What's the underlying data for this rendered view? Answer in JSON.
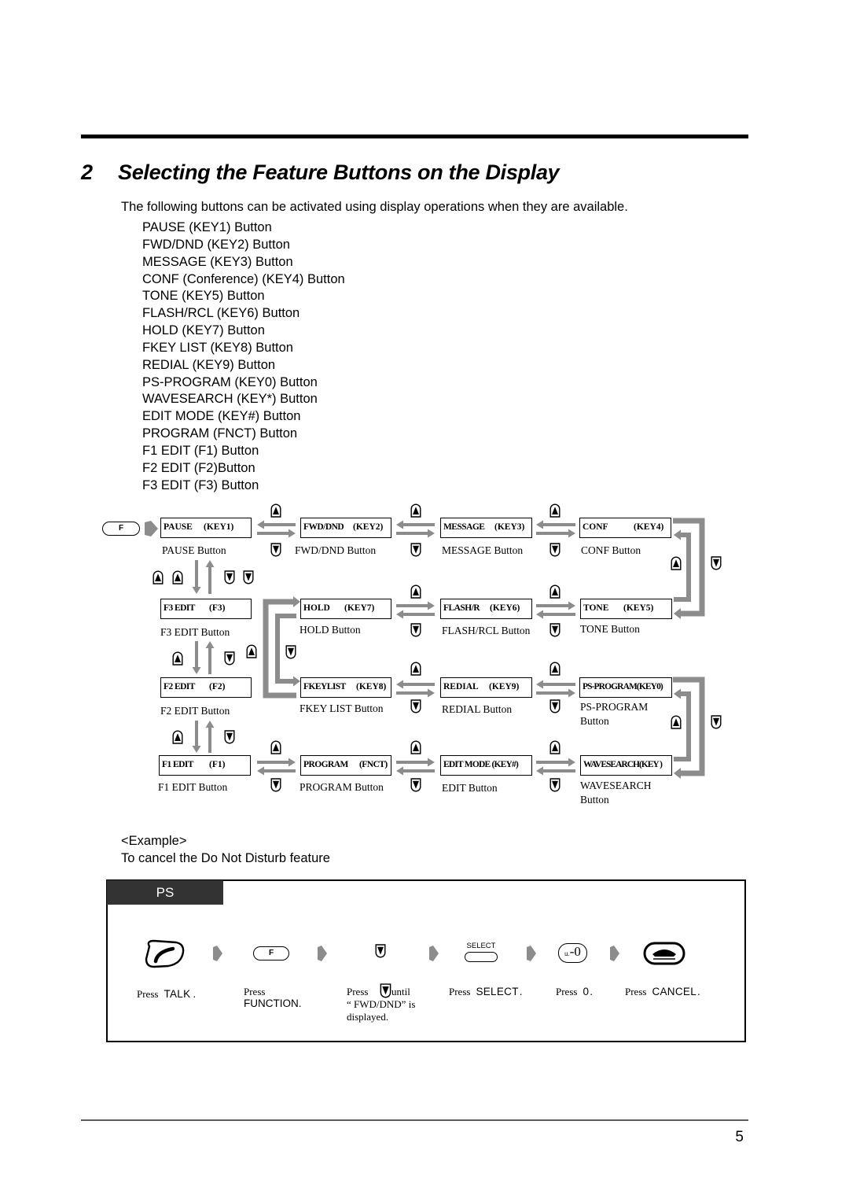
{
  "header": {
    "section_number": "2",
    "title": "Selecting the Feature Buttons on the Display"
  },
  "intro": "The following buttons can be activated using display operations when they are available.",
  "button_list": [
    "PAUSE (KEY1) Button",
    "FWD/DND (KEY2) Button",
    "MESSAGE (KEY3) Button",
    "CONF (Conference) (KEY4) Button",
    "TONE (KEY5) Button",
    "FLASH/RCL (KEY6) Button",
    "HOLD (KEY7) Button",
    "FKEY LIST (KEY8) Button",
    "REDIAL (KEY9) Button",
    "PS-PROGRAM (KEY0) Button",
    "WAVESEARCH (KEY*) Button",
    "EDIT MODE (KEY#) Button",
    "PROGRAM (FNCT) Button",
    "F1 EDIT (F1) Button",
    "F2 EDIT (F2)Button",
    "F3 EDIT (F3) Button"
  ],
  "diagram": {
    "start_key_label": "F",
    "keys": {
      "pause": {
        "name": "PAUSE",
        "code": "(KEY1)",
        "caption": "PAUSE Button"
      },
      "fwd_dnd": {
        "name": "FWD/DND",
        "code": "(KEY2)",
        "caption": "FWD/DND Button"
      },
      "message": {
        "name": "MESSAGE",
        "code": "(KEY3)",
        "caption": "MESSAGE Button"
      },
      "conf": {
        "name": "CONF",
        "code": "(KEY4)",
        "caption": "CONF Button"
      },
      "f3_edit": {
        "name": "F3 EDIT",
        "code": "(F3)",
        "caption": "F3 EDIT Button"
      },
      "hold": {
        "name": "HOLD",
        "code": "(KEY7)",
        "caption": "HOLD Button"
      },
      "flash": {
        "name": "FLASH/R",
        "code": "(KEY6)",
        "caption": "FLASH/RCL Button"
      },
      "tone": {
        "name": "TONE",
        "code": "(KEY5)",
        "caption": "TONE Button"
      },
      "f2_edit": {
        "name": "F2 EDIT",
        "code": "(F2)",
        "caption": "F2 EDIT Button"
      },
      "fkey_list": {
        "name": "FKEYLIST",
        "code": "(KEY8)",
        "caption": "FKEY LIST Button"
      },
      "redial": {
        "name": "REDIAL",
        "code": "(KEY9)",
        "caption": "REDIAL Button"
      },
      "ps_program": {
        "name": "PS-PROGRAM(KEY0)",
        "caption": "PS-PROGRAM",
        "caption2": "Button"
      },
      "f1_edit": {
        "name": "F1 EDIT",
        "code": "(F1)",
        "caption": "F1 EDIT Button"
      },
      "program": {
        "name": "PROGRAM",
        "code": "(FNCT)",
        "caption": "PROGRAM Button"
      },
      "edit_mode": {
        "name": "EDIT MODE (KEY#)",
        "caption": "EDIT Button"
      },
      "wavesearch": {
        "name": "WAVESEARCH(KEY )",
        "caption": "WAVESEARCH",
        "caption2": "Button"
      }
    }
  },
  "example": {
    "heading": "<Example>",
    "description": "To cancel the Do Not Disturb feature",
    "panel_label": "PS",
    "steps": [
      {
        "icon": "talk-key",
        "prefix": "Press",
        "key": "TALK",
        "suffix": "."
      },
      {
        "icon": "function-key",
        "icon_label": "F",
        "prefix": "Press",
        "key": "FUNCTION",
        "suffix": "."
      },
      {
        "icon": "down-key",
        "prefix": "Press",
        "suffix": "until",
        "line2": "“ FWD/DND”  is",
        "line3": "displayed."
      },
      {
        "icon": "select-key",
        "icon_label": "SELECT",
        "prefix": "Press",
        "key": "SELECT",
        "suffix": "."
      },
      {
        "icon": "zero-key",
        "icon_label_small": "u.",
        "icon_label": "-0",
        "prefix": "Press",
        "key": "0",
        "suffix": "."
      },
      {
        "icon": "cancel-key",
        "prefix": "Press",
        "key": "CANCEL",
        "suffix": "."
      }
    ]
  },
  "footer": {
    "page_number": "5"
  },
  "colors": {
    "arrow_gray": "#8c8c8c",
    "panel_tab_bg": "#333333"
  }
}
